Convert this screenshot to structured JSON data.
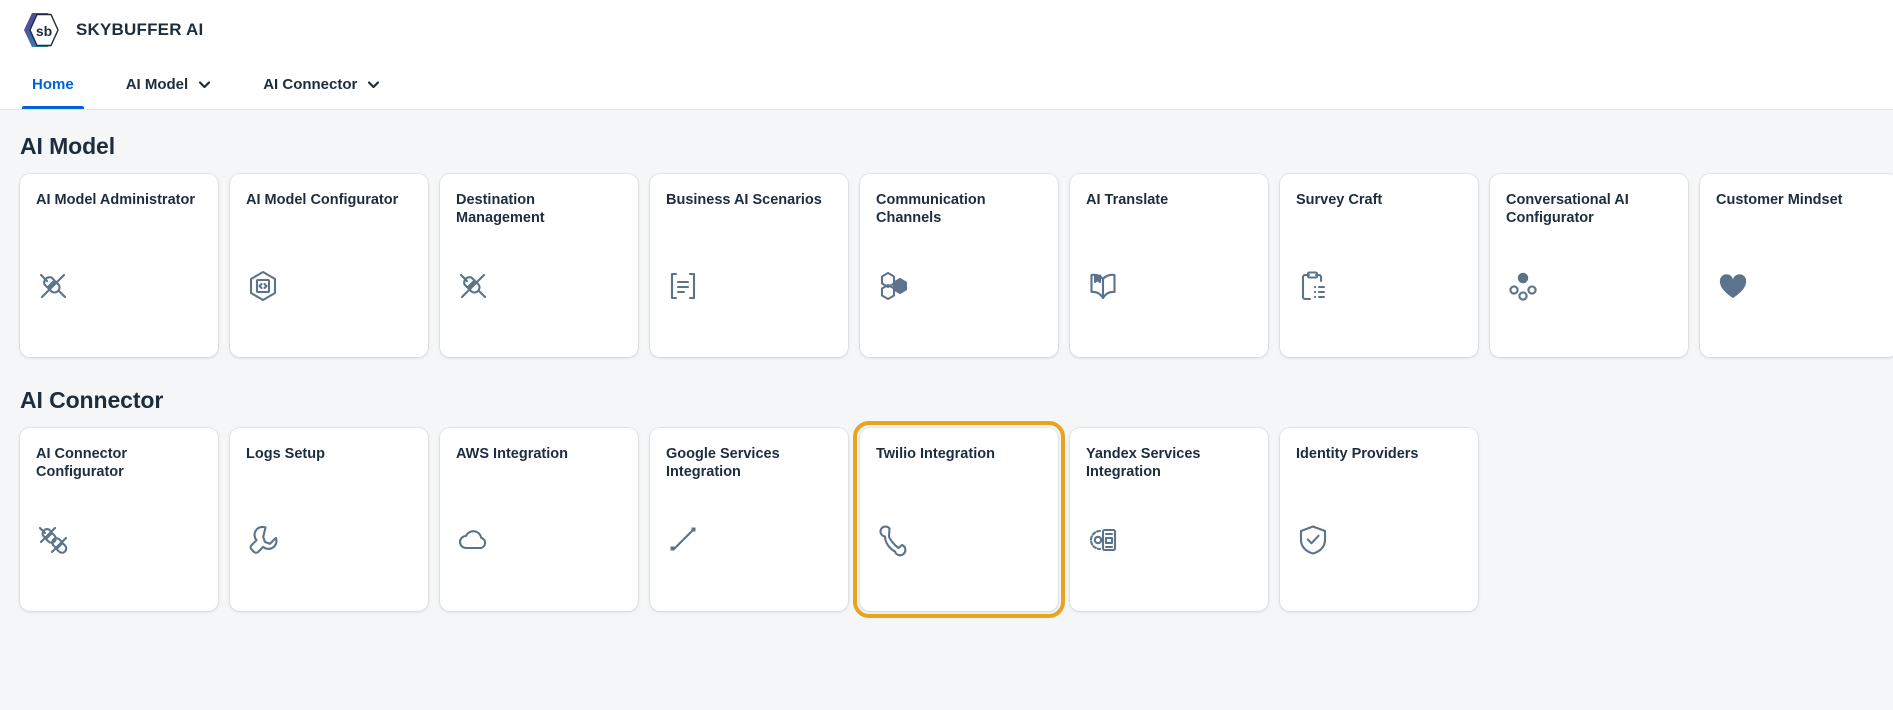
{
  "app": {
    "logo_icon": "skybuffer-hexagon-logo",
    "title": "SKYBUFFER AI",
    "brand_colors": {
      "purple": "#5b3a8e",
      "teal": "#1aa68a",
      "text": "#1d2d3e"
    }
  },
  "tabs": [
    {
      "label": "Home",
      "selected": true,
      "has_menu": false,
      "name": "tab-home"
    },
    {
      "label": "AI Model",
      "selected": false,
      "has_menu": true,
      "name": "tab-ai-model"
    },
    {
      "label": "AI Connector",
      "selected": false,
      "has_menu": true,
      "name": "tab-ai-connector"
    }
  ],
  "theme": {
    "accent": "#0064d9",
    "focus_ring": "#e9a320",
    "page_bg": "#f5f6f7",
    "card_bg": "#ffffff",
    "icon_color": "#5b738b",
    "text_color": "#1d2d3e"
  },
  "sections": [
    {
      "name": "ai-model",
      "title": "AI Model",
      "cards": [
        {
          "title": "AI Model Administrator",
          "icon": "plug-disconnected-icon",
          "focused": false
        },
        {
          "title": "AI Model Configurator",
          "icon": "hexagon-code-icon",
          "focused": false
        },
        {
          "title": "Destination Management",
          "icon": "plug-disconnected-icon",
          "focused": false
        },
        {
          "title": "Business AI Scenarios",
          "icon": "document-brackets-icon",
          "focused": false
        },
        {
          "title": "Communication Channels",
          "icon": "hexagon-cluster-icon",
          "focused": false
        },
        {
          "title": "AI Translate",
          "icon": "open-book-icon",
          "focused": false
        },
        {
          "title": "Survey Craft",
          "icon": "clipboard-list-icon",
          "focused": false
        },
        {
          "title": "Conversational AI Configurator",
          "icon": "dots-cluster-icon",
          "focused": false
        },
        {
          "title": "Customer Mindset",
          "icon": "heart-icon",
          "focused": false
        }
      ]
    },
    {
      "name": "ai-connector",
      "title": "AI Connector",
      "cards": [
        {
          "title": "AI Connector Configurator",
          "icon": "double-plug-icon",
          "focused": false
        },
        {
          "title": "Logs Setup",
          "icon": "wrench-icon",
          "focused": false
        },
        {
          "title": "AWS Integration",
          "icon": "cloud-icon",
          "focused": false
        },
        {
          "title": "Google Services Integration",
          "icon": "diagonal-line-icon",
          "focused": false
        },
        {
          "title": "Twilio Integration",
          "icon": "phone-icon",
          "focused": true
        },
        {
          "title": "Yandex Services Integration",
          "icon": "gear-document-icon",
          "focused": false
        },
        {
          "title": "Identity Providers",
          "icon": "shield-check-icon",
          "focused": false
        }
      ]
    }
  ]
}
